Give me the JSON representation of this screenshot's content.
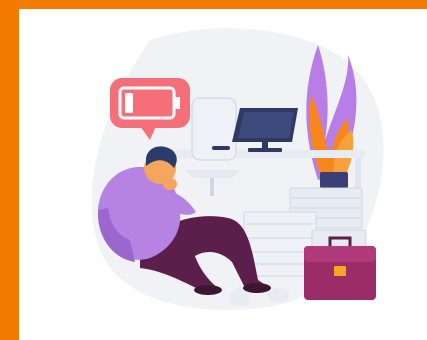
{
  "colors": {
    "frame": "#f27c00",
    "background": "#ffffff",
    "backdrop_blob": "#f1f2f6",
    "battery_bubble": "#f46f78",
    "battery_level": "#ffffff",
    "monitor": "#2f3a64",
    "desk": "#e7ecf3",
    "papers": "#dfe5ee",
    "briefcase": "#9a2c68",
    "briefcase_clasp": "#f6a623",
    "plant_pot": "#3a3f78",
    "person_shirt": "#b783e3",
    "person_pants": "#5c1f4c",
    "person_skin": "#f5a55c",
    "person_hair": "#2c3c6a",
    "flame_orange": "#f7861b",
    "flame_purple": "#b77ee8"
  },
  "illustration": {
    "subject": "tired-person-sitting-by-desk",
    "battery_level": 0.15,
    "icons": [
      "battery-low-icon",
      "monitor-icon",
      "briefcase-icon",
      "plant-icon"
    ]
  }
}
